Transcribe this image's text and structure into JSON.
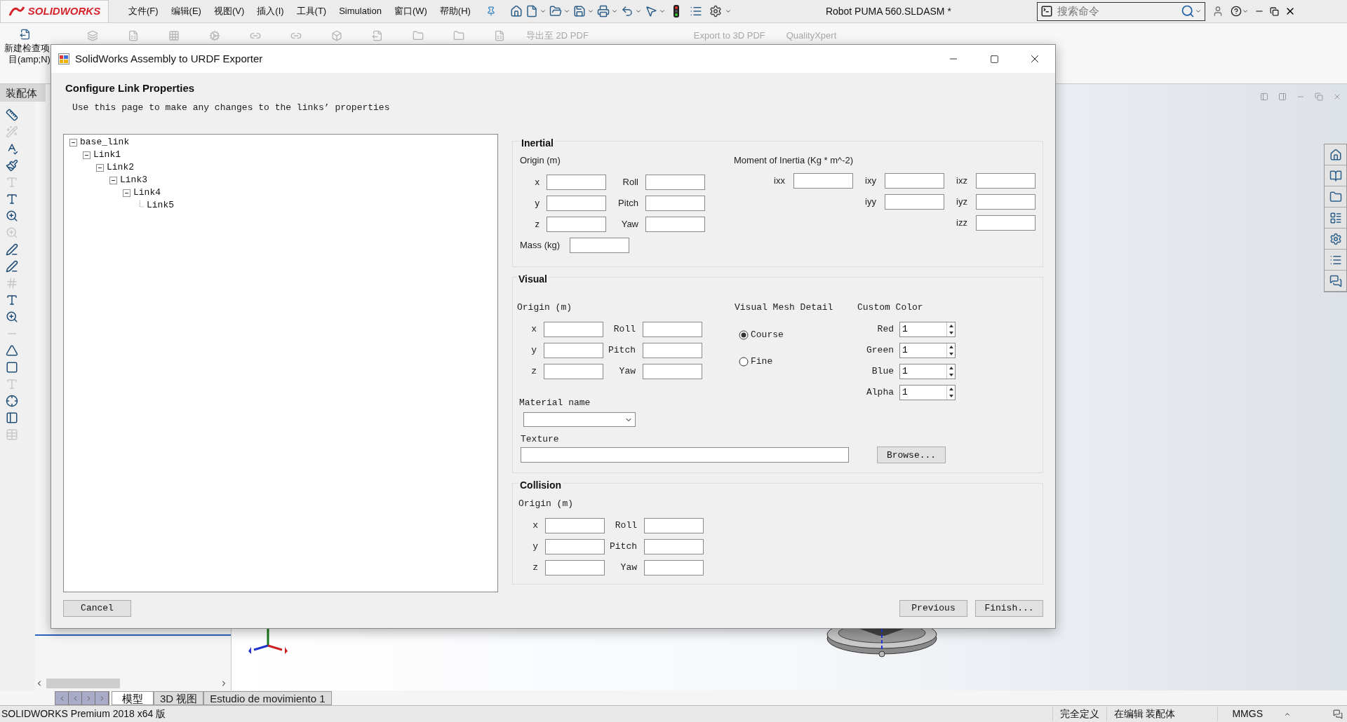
{
  "app": {
    "logo": "SOLIDWORKS",
    "menus": [
      "文件(F)",
      "编辑(E)",
      "视图(V)",
      "插入(I)",
      "工具(T)",
      "Simulation",
      "窗口(W)",
      "帮助(H)"
    ],
    "title": "Robot PUMA 560.SLDASM *",
    "search": {
      "placeholder": "搜索命令"
    }
  },
  "toolbar": {
    "new_check_item": [
      "新建检查项",
      "目(amp;N)"
    ],
    "commands": [
      "导出至 2D PDF",
      "Export to 3D PDF",
      "QualityXpert"
    ]
  },
  "left_tab": "装配体",
  "dialog": {
    "title": "SolidWorks Assembly to URDF Exporter",
    "heading": "Configure Link Properties",
    "subtitle": "Use this page to make any changes to the links’ properties",
    "tree": [
      {
        "label": "base_link",
        "expanded": true,
        "children": [
          {
            "label": "Link1",
            "expanded": true,
            "children": [
              {
                "label": "Link2",
                "expanded": true,
                "children": [
                  {
                    "label": "Link3",
                    "expanded": true,
                    "children": [
                      {
                        "label": "Link4",
                        "expanded": true,
                        "children": [
                          {
                            "label": "Link5"
                          }
                        ]
                      }
                    ]
                  }
                ]
              }
            ]
          }
        ]
      }
    ],
    "inertial": {
      "title": "Inertial",
      "origin": {
        "label": "Origin (m)",
        "rows": [
          [
            "x",
            "Roll"
          ],
          [
            "y",
            "Pitch"
          ],
          [
            "z",
            "Yaw"
          ]
        ]
      },
      "moment": {
        "label": "Moment of Inertia (Kg * m^-2)",
        "rows": [
          [
            "ixx",
            "ixy",
            "ixz"
          ],
          [
            "",
            "iyy",
            "iyz"
          ],
          [
            "",
            "",
            "izz"
          ]
        ]
      },
      "mass_label": "Mass (kg)"
    },
    "visual": {
      "title": "Visual",
      "origin": {
        "label": "Origin (m)",
        "rows": [
          [
            "x",
            "Roll"
          ],
          [
            "y",
            "Pitch"
          ],
          [
            "z",
            "Yaw"
          ]
        ]
      },
      "mesh_detail": {
        "label": "Visual Mesh Detail",
        "options": [
          {
            "label": "Course",
            "selected": true
          },
          {
            "label": "Fine",
            "selected": false
          }
        ]
      },
      "custom_color": {
        "label": "Custom Color",
        "channels": [
          {
            "label": "Red",
            "value": "1"
          },
          {
            "label": "Green",
            "value": "1"
          },
          {
            "label": "Blue",
            "value": "1"
          },
          {
            "label": "Alpha",
            "value": "1"
          }
        ]
      },
      "material_label": "Material name",
      "texture_label": "Texture",
      "browse": "Browse..."
    },
    "collision": {
      "title": "Collision",
      "origin": {
        "label": "Origin (m)",
        "rows": [
          [
            "x",
            "Roll"
          ],
          [
            "y",
            "Pitch"
          ],
          [
            "z",
            "Yaw"
          ]
        ]
      }
    },
    "buttons": {
      "cancel": "Cancel",
      "previous": "Previous",
      "finish": "Finish..."
    }
  },
  "bottom_tabs": [
    {
      "label": "模型",
      "selected": true
    },
    {
      "label": "3D 视图",
      "selected": false
    },
    {
      "label": "Estudio de movimiento 1",
      "selected": false
    }
  ],
  "status_bar": {
    "product": "SOLIDWORKS Premium 2018 x64 版",
    "items": [
      "完全定义",
      "在编辑 装配体",
      "MMGS"
    ]
  }
}
